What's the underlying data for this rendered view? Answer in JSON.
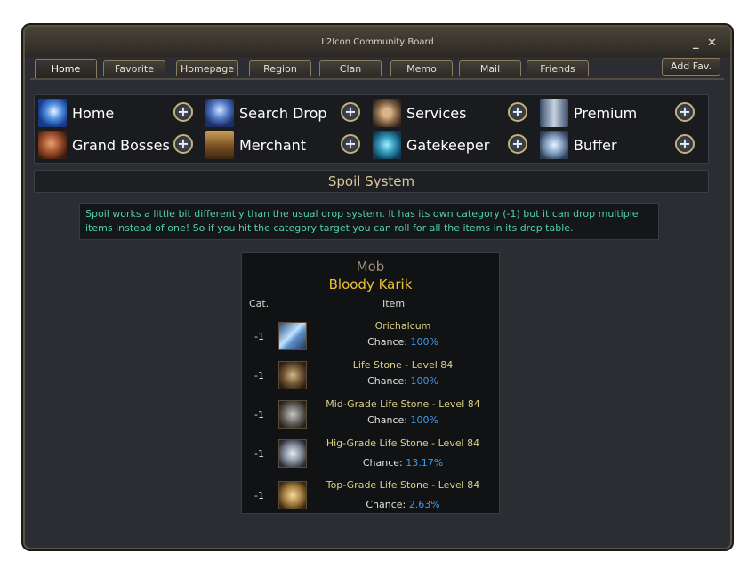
{
  "window": {
    "title": "L2Icon Community Board"
  },
  "tabs": [
    "Home",
    "Favorite",
    "Homepage",
    "Region",
    "Clan",
    "Memo",
    "Mail",
    "Friends"
  ],
  "add_fav": "Add Fav.",
  "nav": [
    "Home",
    "Search Drop",
    "Services",
    "Premium",
    "Grand Bosses",
    "Merchant",
    "Gatekeeper",
    "Buffer"
  ],
  "nav_icons": [
    "sparkle-icon",
    "search-drop-icon",
    "gear-icon",
    "sword-icon",
    "dragon-icon",
    "chest-icon",
    "portal-icon",
    "armor-icon"
  ],
  "section_title": "Spoil System",
  "description": "Spoil works a little bit differently than the usual drop system. It has its own category (-1) but it can drop multiple items instead of one! So if you hit the category target you can roll for all the items in its drop table.",
  "mob": {
    "label": "Mob",
    "name": "Bloody Karik",
    "col_cat": "Cat.",
    "col_item": "Item",
    "chance_label": "Chance:",
    "items": [
      {
        "cat": "-1",
        "name": "Orichalcum",
        "chance": "100%",
        "icon": "orichalcum-icon"
      },
      {
        "cat": "-1",
        "name": "Life Stone - Level 84",
        "chance": "100%",
        "icon": "life-stone-icon"
      },
      {
        "cat": "-1",
        "name": "Mid-Grade Life Stone - Level 84",
        "chance": "100%",
        "icon": "mid-grade-life-stone-icon"
      },
      {
        "cat": "-1",
        "name": "Hig-Grade Life Stone - Level 84",
        "chance": "13.17%",
        "icon": "high-grade-life-stone-icon"
      },
      {
        "cat": "-1",
        "name": "Top-Grade Life Stone - Level 84",
        "chance": "2.63%",
        "icon": "top-grade-life-stone-icon"
      }
    ]
  },
  "colors": {
    "accent_gold": "#f2c13a",
    "chance_blue": "#3f9ae8",
    "desc_green": "#4fd3a0",
    "item_name": "#d9cf8a"
  }
}
